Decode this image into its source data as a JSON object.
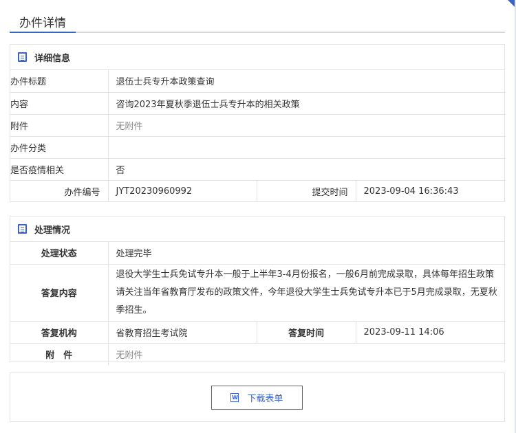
{
  "page": {
    "title": "办件详情"
  },
  "detail": {
    "heading": "详细信息",
    "rows": [
      {
        "label": "办件标题",
        "value": "退伍士兵专升本政策查询"
      },
      {
        "label": "内容",
        "value": "咨询2023年夏秋季退伍士兵专升本的相关政策"
      },
      {
        "label": "附件",
        "value": "无附件"
      },
      {
        "label": "办件分类",
        "value": ""
      },
      {
        "label": "是否疫情相关",
        "value": "否"
      }
    ],
    "number_label": "办件编号",
    "number_value": "JYT20230960992",
    "submit_label": "提交时间",
    "submit_value": "2023-09-04 16:36:43"
  },
  "handling": {
    "heading": "处理情况",
    "status_label": "处理状态",
    "status_value": "处理完毕",
    "reply_label": "答复内容",
    "reply_value": "退役大学生士兵免试专升本一般于上半年3-4月份报名，一般6月前完成录取，具体每年招生政策请关注当年省教育厅发布的政策文件，今年退役大学生士兵免试专升本已于5月完成录取，无夏秋季招生。",
    "org_label": "答复机构",
    "org_value": "省教育招生考试院",
    "time_label": "答复时间",
    "time_value": "2023-09-11 14:06",
    "attach_label": "附　件",
    "attach_value": "无附件"
  },
  "download": {
    "label": "下载表单",
    "icon": "word-doc-icon"
  },
  "colors": {
    "accent": "#3b63c4",
    "border": "#e3e3e3",
    "muted": "#888888"
  }
}
